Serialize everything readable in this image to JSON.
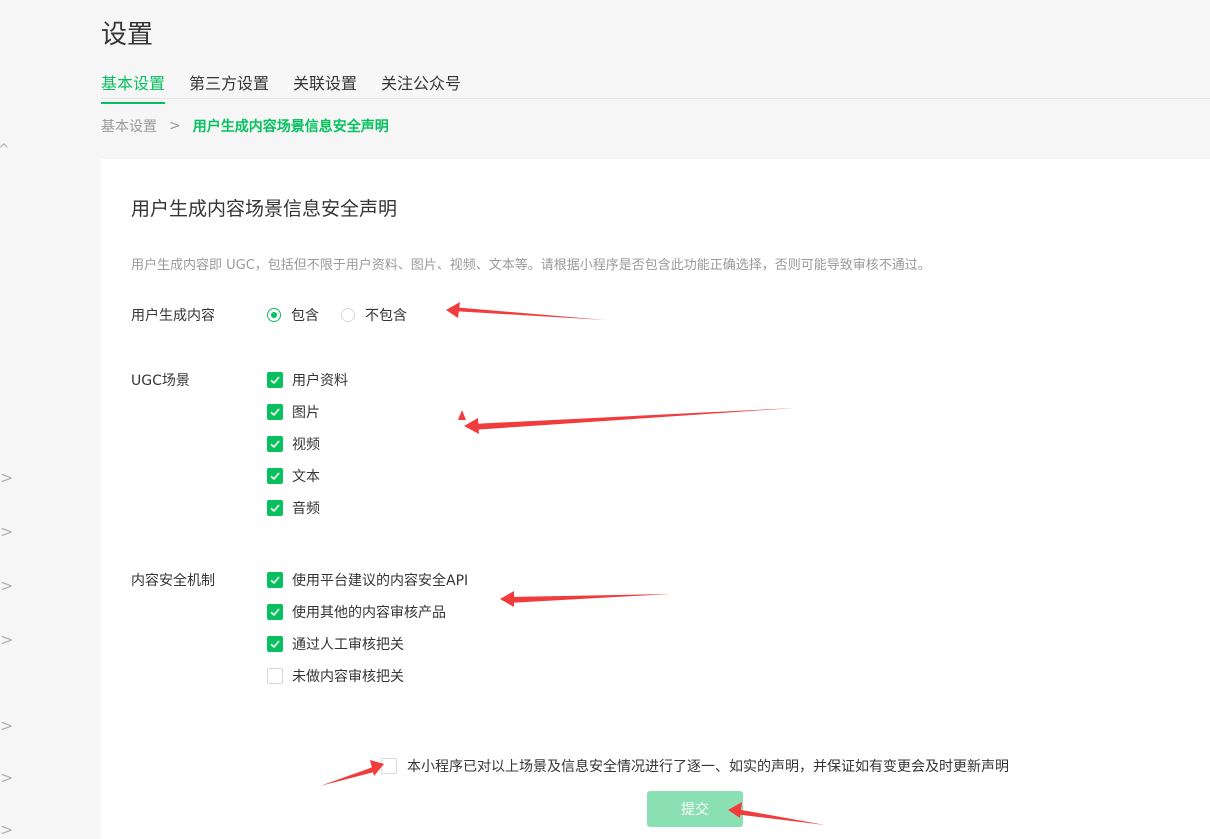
{
  "page": {
    "title": "设置"
  },
  "tabs": [
    "基本设置",
    "第三方设置",
    "关联设置",
    "关注公众号"
  ],
  "breadcrumb": {
    "home": "基本设置",
    "separator": ">",
    "current": "用户生成内容场景信息安全声明"
  },
  "panel": {
    "title": "用户生成内容场景信息安全声明",
    "description": "用户生成内容即 UGC，包括但不限于用户资料、图片、视频、文本等。请根据小程序是否包含此功能正确选择，否则可能导致审核不通过。"
  },
  "ugc_content": {
    "label": "用户生成内容",
    "options": [
      {
        "label": "包含",
        "checked": true
      },
      {
        "label": "不包含",
        "checked": false
      }
    ]
  },
  "ugc_scenes": {
    "label": "UGC场景",
    "items": [
      {
        "label": "用户资料",
        "checked": true
      },
      {
        "label": "图片",
        "checked": true
      },
      {
        "label": "视频",
        "checked": true
      },
      {
        "label": "文本",
        "checked": true
      },
      {
        "label": "音频",
        "checked": true
      }
    ]
  },
  "security": {
    "label": "内容安全机制",
    "items": [
      {
        "label": "使用平台建议的内容安全API",
        "checked": true
      },
      {
        "label": "使用其他的内容审核产品",
        "checked": true
      },
      {
        "label": "通过人工审核把关",
        "checked": true
      },
      {
        "label": "未做内容审核把关",
        "checked": false
      }
    ]
  },
  "declaration": {
    "text": "本小程序已对以上场景及信息安全情况进行了逐一、如实的声明，并保证如有变更会及时更新声明",
    "checked": false
  },
  "submit": {
    "label": "提交"
  },
  "colors": {
    "accent": "#07c160",
    "submit_disabled": "#8be0b3",
    "annotation_arrow": "#f03c3c"
  }
}
